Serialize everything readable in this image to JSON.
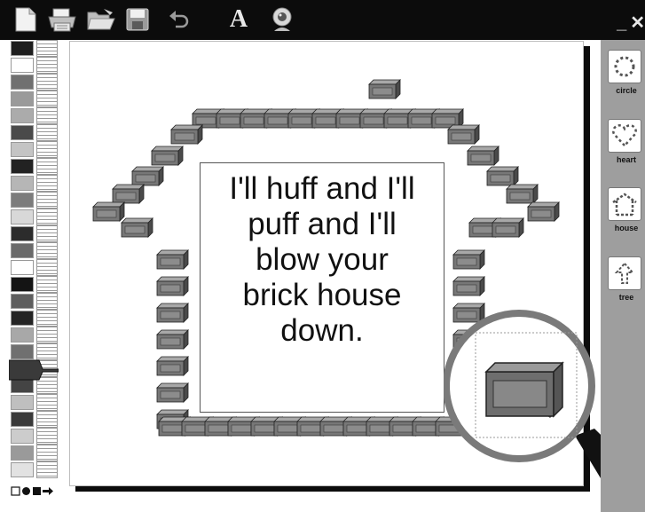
{
  "toolbar": {
    "tools": [
      {
        "icon": "new-page-icon"
      },
      {
        "icon": "printer-icon"
      },
      {
        "icon": "open-folder-icon"
      },
      {
        "icon": "save-disk-icon"
      },
      {
        "icon": "undo-icon"
      },
      {
        "icon": "text-tool-icon",
        "label": "A"
      },
      {
        "icon": "webcam-icon"
      }
    ],
    "minimize_label": "_",
    "close_label": "✕"
  },
  "palette": {
    "colors": [
      "#1e1e1e",
      "#ffffff",
      "#707070",
      "#9a9a9a",
      "#ababab",
      "#4a4a4a",
      "#c4c4c4",
      "#222222",
      "#b6b6b6",
      "#7c7c7c",
      "#d8d8d8",
      "#2c2c2c",
      "#6a6a6a",
      "#ffffff",
      "#141414",
      "#5e5e5e",
      "#242424",
      "#a8a8a8",
      "#707070",
      "#8a8a8a",
      "#444444",
      "#bfbfbf",
      "#3a3a3a",
      "#cccccc",
      "#9a9a9a",
      "#e2e2e2"
    ],
    "selected_index": 18,
    "shape_tools": [
      "open-square-icon",
      "filled-circle-icon",
      "filled-square-icon",
      "arrow-icon"
    ]
  },
  "canvas": {
    "text": "I'll huff and I'll\npuff and I'll\nblow your\nbrick house\ndown."
  },
  "stamps": [
    {
      "icon": "circle-stamp-icon",
      "label": "circle"
    },
    {
      "icon": "heart-stamp-icon",
      "label": "heart"
    },
    {
      "icon": "house-stamp-icon",
      "label": "house"
    },
    {
      "icon": "tree-stamp-icon",
      "label": "tree"
    }
  ],
  "colors": {
    "toolbar_bg": "#0c0c0c",
    "panel_bg": "#9e9e9e",
    "brick": "#777777"
  }
}
